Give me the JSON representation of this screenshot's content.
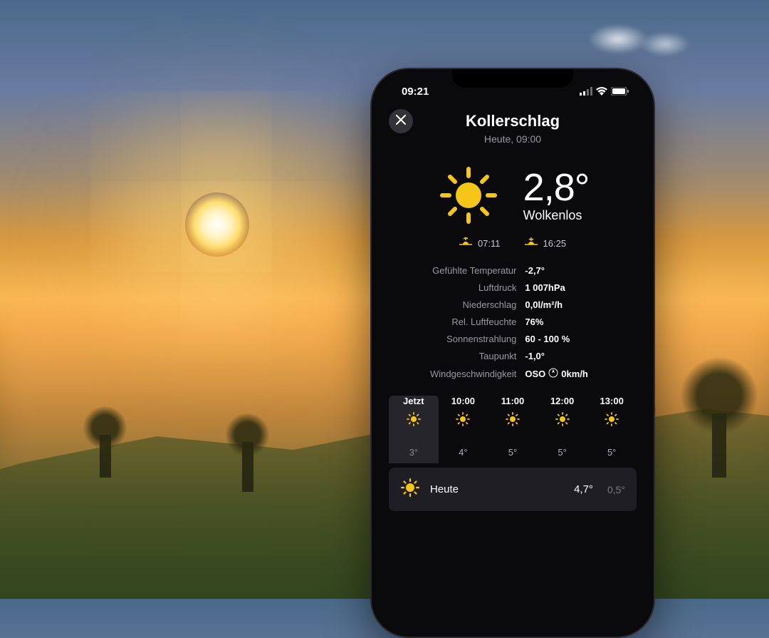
{
  "status_bar": {
    "time": "09:21"
  },
  "header": {
    "location": "Kollerschlag",
    "subtitle": "Heute, 09:00"
  },
  "hero": {
    "temperature": "2,8°",
    "condition": "Wolkenlos",
    "sunrise": "07:11",
    "sunset": "16:25"
  },
  "details": [
    {
      "label": "Gefühlte Temperatur",
      "value": "-2,7°"
    },
    {
      "label": "Luftdruck",
      "value": "1 007hPa"
    },
    {
      "label": "Niederschlag",
      "value": "0,0l/m²/h"
    },
    {
      "label": "Rel. Luftfeuchte",
      "value": "76%"
    },
    {
      "label": "Sonnenstrahlung",
      "value": "60 - 100 %"
    },
    {
      "label": "Taupunkt",
      "value": "-1,0°"
    },
    {
      "label": "Windgeschwindigkeit",
      "value": "OSO",
      "speed": "0km/h"
    }
  ],
  "hourly": [
    {
      "time": "Jetzt",
      "temp": "3°",
      "active": true
    },
    {
      "time": "10:00",
      "temp": "4°"
    },
    {
      "time": "11:00",
      "temp": "5°"
    },
    {
      "time": "12:00",
      "temp": "5°"
    },
    {
      "time": "13:00",
      "temp": "5°"
    }
  ],
  "daily": {
    "label": "Heute",
    "hi": "4,7°",
    "lo": "0,5°"
  },
  "colors": {
    "accent": "#f5c518"
  }
}
